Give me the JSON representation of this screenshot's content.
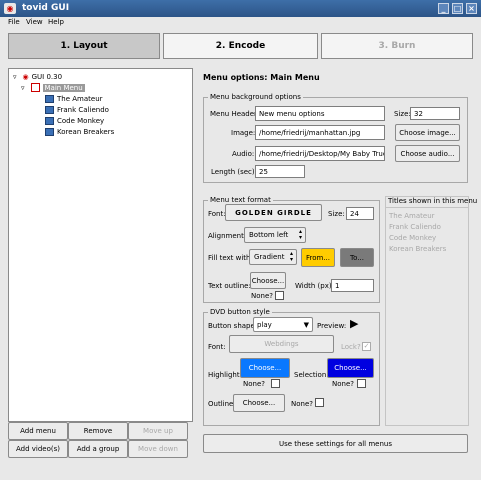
{
  "window": {
    "title": "tovid GUI"
  },
  "menubar": {
    "file": "File",
    "view": "View",
    "help": "Help"
  },
  "tabs": [
    {
      "label": "1. Layout"
    },
    {
      "label": "2. Encode"
    },
    {
      "label": "3. Burn"
    }
  ],
  "tree": {
    "root": "GUI 0.30",
    "menu": "Main Menu",
    "items": [
      "The Amateur",
      "Frank Caliendo",
      "Code Monkey",
      "Korean Breakers"
    ]
  },
  "left_buttons": {
    "add_menu": "Add menu",
    "remove": "Remove",
    "move_up": "Move up",
    "add_videos": "Add video(s)",
    "add_group": "Add a group",
    "move_down": "Move down"
  },
  "panel": {
    "heading": "Menu options: Main Menu",
    "background": {
      "group_title": "Menu background options",
      "header_label": "Menu Header:",
      "header_value": "New menu options",
      "size_label": "Size:",
      "size_value": "32",
      "image_label": "Image:",
      "image_value": "/home/friedrij/manhattan.jpg",
      "choose_image": "Choose image...",
      "audio_label": "Audio:",
      "audio_value": "/home/friedrij/Desktop/My Baby True.mp3",
      "choose_audio": "Choose audio...",
      "length_label": "Length (sec):",
      "length_value": "25"
    },
    "text_format": {
      "group_title": "Menu text format",
      "font_label": "Font:",
      "font_value": "GOLDEN GIRDLE",
      "size_label": "Size:",
      "size_value": "24",
      "alignment_label": "Alignment:",
      "alignment_value": "Bottom left",
      "fill_label": "Fill text with:",
      "fill_value": "Gradient",
      "from_label": "From...",
      "to_label": "To...",
      "outline_label": "Text outline:",
      "outline_choose": "Choose...",
      "width_label": "Width (px):",
      "width_value": "1",
      "none_label": "None?"
    },
    "titles_list": {
      "group_title": "Titles shown in this menu",
      "items": [
        "The Amateur",
        "Frank Caliendo",
        "Code Monkey",
        "Korean Breakers"
      ]
    },
    "dvd_button": {
      "group_title": "DVD button style",
      "shape_label": "Button shape:",
      "shape_value": "play",
      "preview_label": "Preview:",
      "font_label": "Font:",
      "font_value": "Webdings",
      "lock_label": "Lock?",
      "highlight_label": "Highlight:",
      "highlight_choose": "Choose...",
      "selection_label": "Selection:",
      "selection_choose": "Choose...",
      "none_label": "None?",
      "outline_label": "Outline:",
      "outline_choose": "Choose...",
      "outline_none": "None?"
    },
    "apply_all": "Use these settings for all menus"
  },
  "colors": {
    "from": "#ffcc00",
    "to": "#7a7a7a",
    "highlight": "#0a78ff",
    "selection": "#0000e0"
  }
}
